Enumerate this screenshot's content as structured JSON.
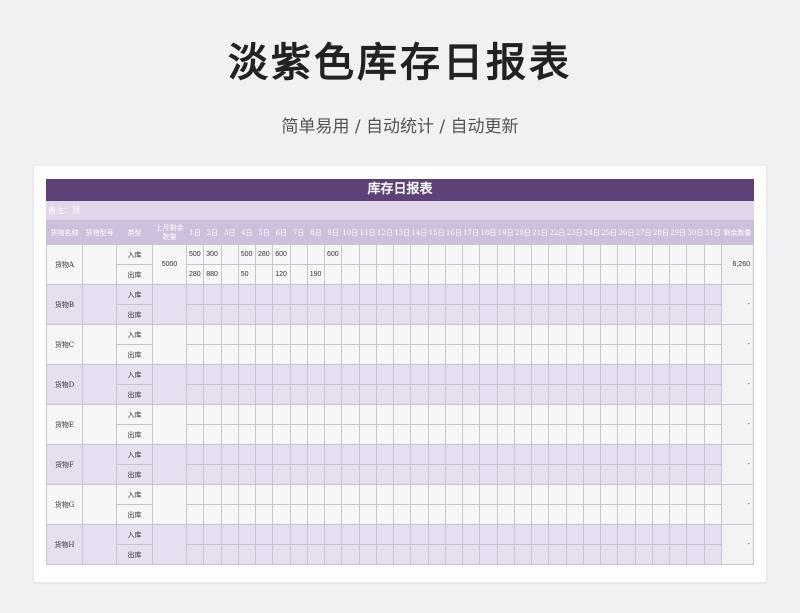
{
  "hero": {
    "title": "淡紫色库存日报表",
    "subtitle": "简单易用 / 自动统计 / 自动更新"
  },
  "sheet": {
    "banner": "库存日报表",
    "remark": "备注：顶",
    "headers": {
      "name": "货物名称",
      "model": "货物型号",
      "type": "类型",
      "last_month": "上月剩余数量",
      "days": [
        "1日",
        "2日",
        "3日",
        "4日",
        "5日",
        "6日",
        "7日",
        "8日",
        "9日",
        "10日",
        "11日",
        "12日",
        "13日",
        "14日",
        "15日",
        "16日",
        "17日",
        "18日",
        "19日",
        "20日",
        "21日",
        "22日",
        "23日",
        "24日",
        "25日",
        "26日",
        "27日",
        "28日",
        "29日",
        "30日",
        "31日"
      ],
      "remain": "剩余数量"
    },
    "in_label": "入库",
    "out_label": "出库",
    "goods": [
      {
        "name": "货物A",
        "model": "",
        "last": "5000",
        "remain": "6,260",
        "in": [
          "500",
          "300",
          "",
          "500",
          "280",
          "600",
          "",
          "",
          "600",
          "",
          "",
          "",
          "",
          "",
          "",
          "",
          "",
          "",
          "",
          "",
          "",
          "",
          "",
          "",
          "",
          "",
          "",
          "",
          "",
          "",
          ""
        ],
        "out": [
          "280",
          "880",
          "",
          "50",
          "",
          "120",
          "",
          "190",
          "",
          "",
          "",
          "",
          "",
          "",
          "",
          "",
          "",
          "",
          "",
          "",
          "",
          "",
          "",
          "",
          "",
          "",
          "",
          "",
          "",
          "",
          ""
        ]
      },
      {
        "name": "货物B",
        "model": "",
        "last": "",
        "remain": "-",
        "in": [],
        "out": []
      },
      {
        "name": "货物C",
        "model": "",
        "last": "",
        "remain": "-",
        "in": [],
        "out": []
      },
      {
        "name": "货物D",
        "model": "",
        "last": "",
        "remain": "-",
        "in": [],
        "out": []
      },
      {
        "name": "货物E",
        "model": "",
        "last": "",
        "remain": "-",
        "in": [],
        "out": []
      },
      {
        "name": "货物F",
        "model": "",
        "last": "",
        "remain": "-",
        "in": [],
        "out": []
      },
      {
        "name": "货物G",
        "model": "",
        "last": "",
        "remain": "-",
        "in": [],
        "out": []
      },
      {
        "name": "货物H",
        "model": "",
        "last": "",
        "remain": "-",
        "in": [],
        "out": []
      }
    ]
  }
}
